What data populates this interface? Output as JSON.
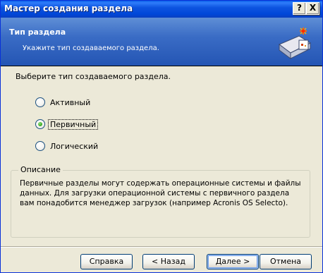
{
  "window": {
    "title": "Мастер создания раздела"
  },
  "titlebar_buttons": {
    "help": "?",
    "close": "X"
  },
  "header": {
    "title": "Тип раздела",
    "subtitle": "Укажите тип создаваемого раздела."
  },
  "prompt": "Выберите тип создаваемого раздела.",
  "options": [
    {
      "label": "Активный",
      "checked": false
    },
    {
      "label": "Первичный",
      "checked": true
    },
    {
      "label": "Логический",
      "checked": false
    }
  ],
  "description": {
    "legend": "Описание",
    "text": "Первичные разделы могут содержать операционные системы и файлы данных. Для загрузки операционной системы с первичного раздела вам понадобится менеджер загрузок (например Acronis OS Selecto)."
  },
  "buttons": {
    "help": "Справка",
    "back": "< Назад",
    "next": "Далее >",
    "cancel": "Отмена"
  },
  "colors": {
    "titlebar": "#0047d8",
    "header": "#3a6cc5",
    "dialog_bg": "#ece9d8",
    "radio_checked": "#3fae2a"
  },
  "icons": {
    "wizard": "disk-wizard-icon"
  }
}
